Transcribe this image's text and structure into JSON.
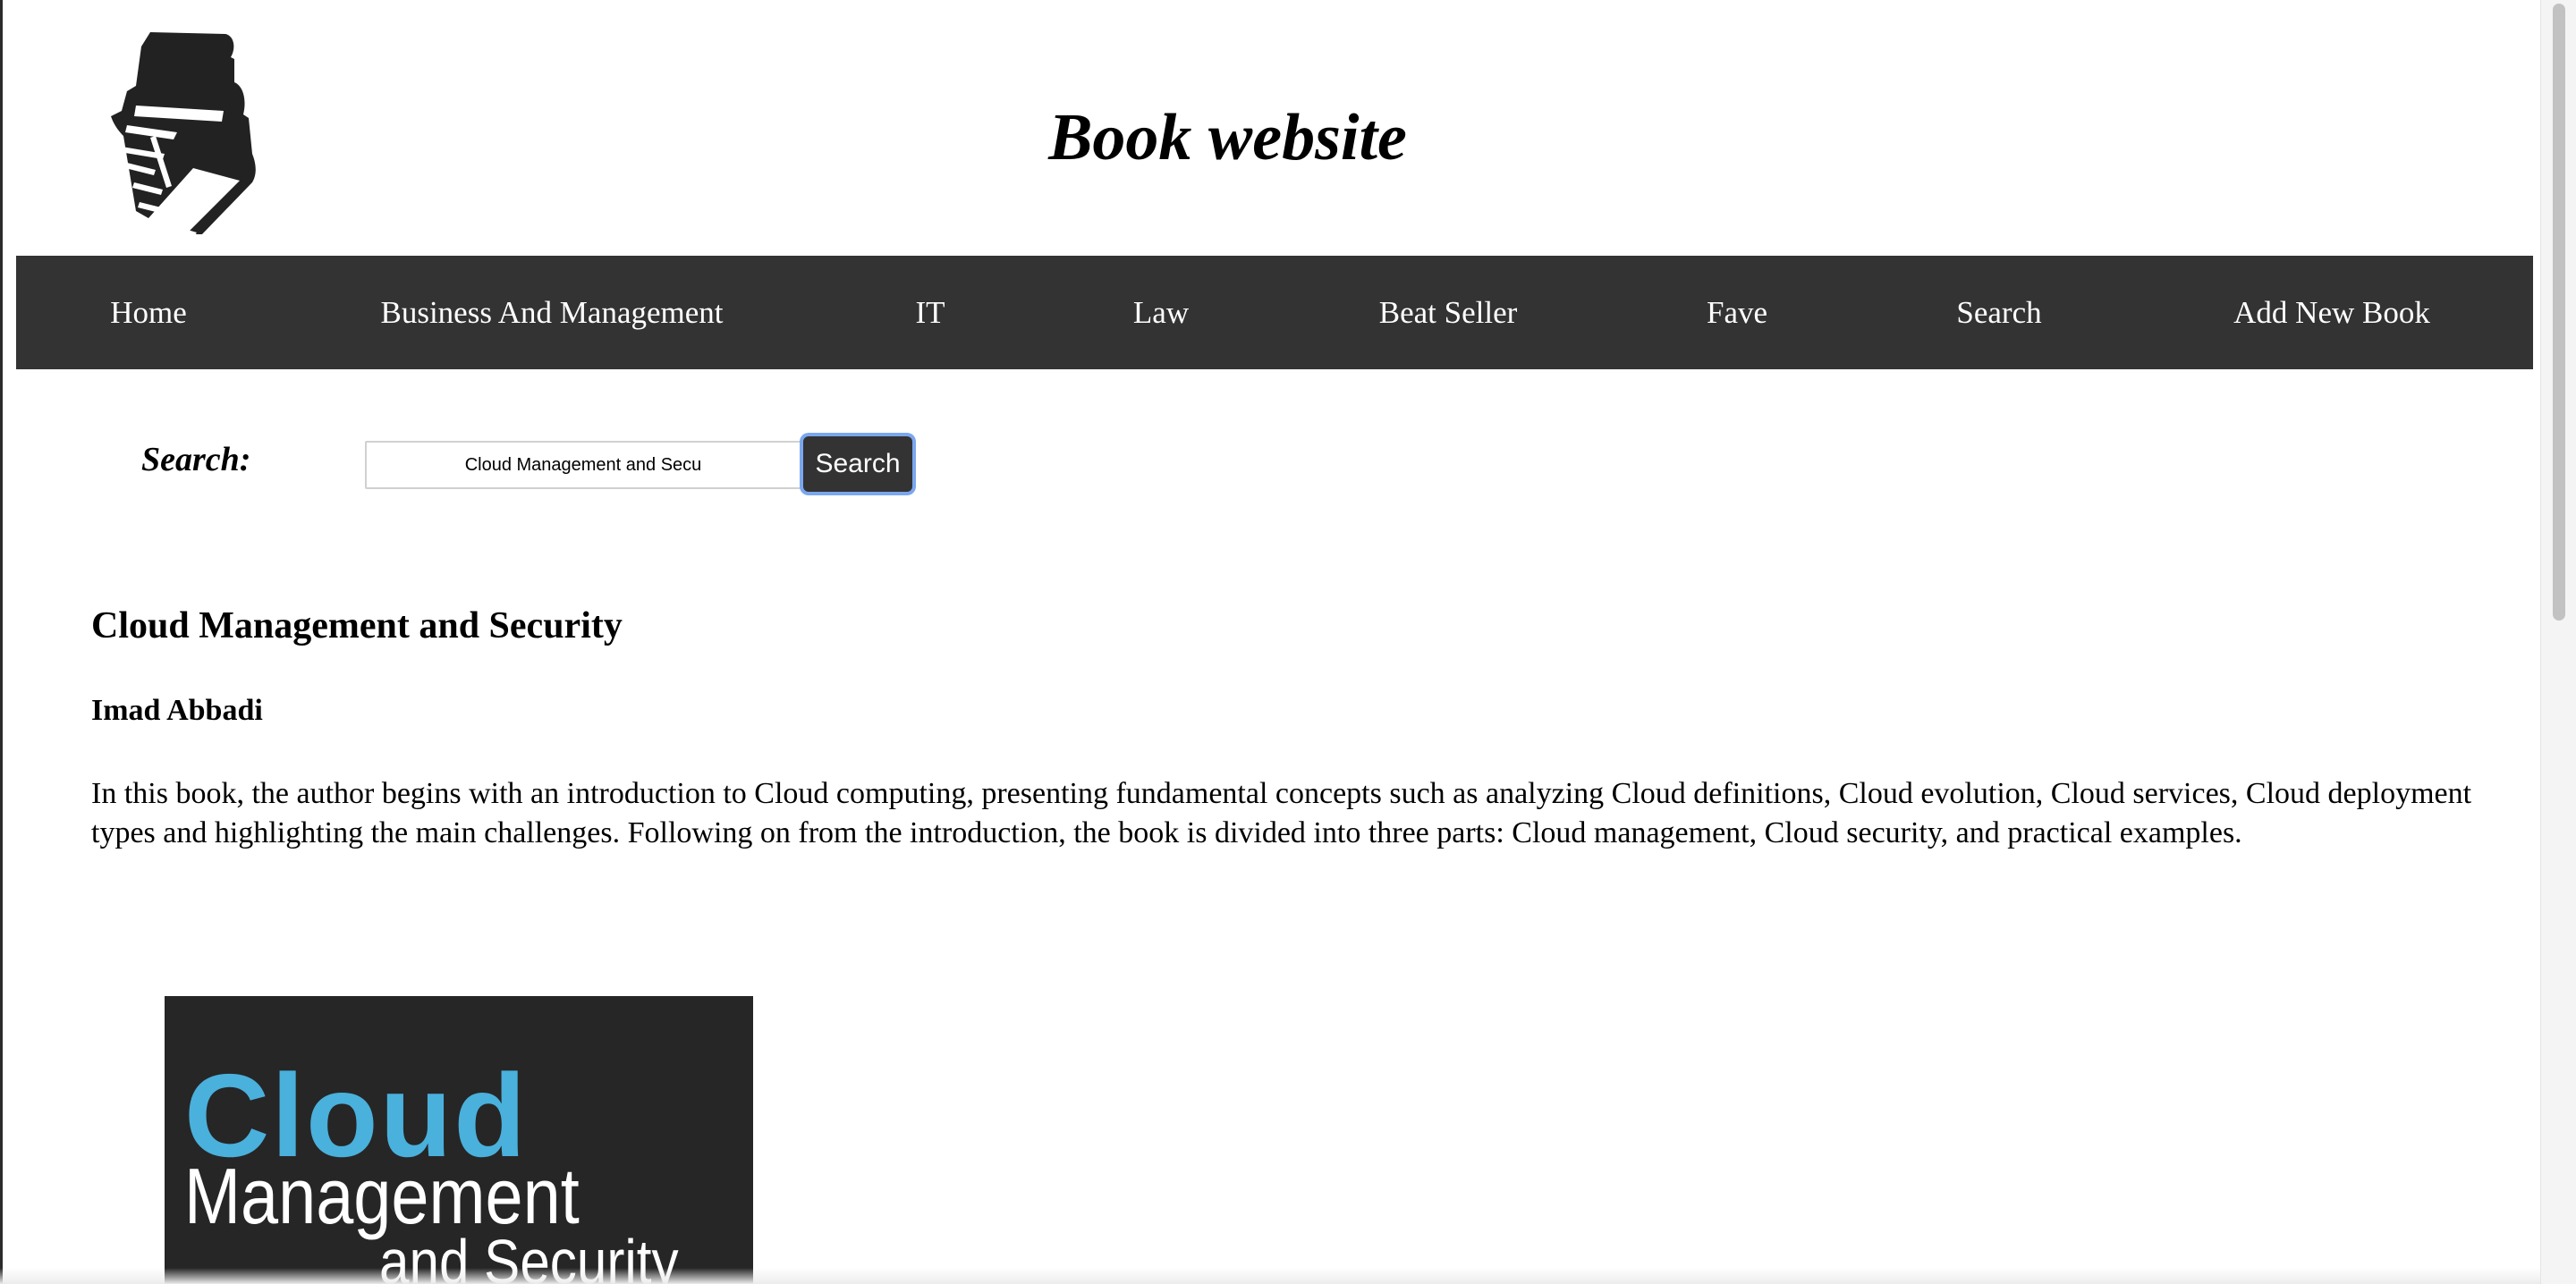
{
  "header": {
    "logo_icon": "book-stack-icon",
    "title": "Book website"
  },
  "nav": {
    "items": [
      {
        "label": "Home"
      },
      {
        "label": "Business And Management"
      },
      {
        "label": "IT"
      },
      {
        "label": "Law"
      },
      {
        "label": "Beat Seller"
      },
      {
        "label": "Fave"
      },
      {
        "label": "Search"
      },
      {
        "label": "Add New Book"
      }
    ]
  },
  "search": {
    "label": "Search:",
    "value": "Cloud Management and Secu",
    "button_label": "Search"
  },
  "book": {
    "title": "Cloud Management and Security",
    "author": "Imad Abbadi",
    "description": "In this book, the author begins with an introduction to Cloud computing, presenting fundamental concepts such as analyzing Cloud definitions, Cloud evolution, Cloud services, Cloud deployment types and highlighting the main challenges. Following on from the introduction, the book is divided into three parts: Cloud management, Cloud security, and practical examples.",
    "cover": {
      "line1": "Cloud",
      "line2": "Management",
      "line3": "and Security"
    }
  },
  "colors": {
    "nav_background": "#333333",
    "nav_text": "#ffffff",
    "cover_accent": "#4ab0dc",
    "focus_ring": "#7ba7ee"
  }
}
